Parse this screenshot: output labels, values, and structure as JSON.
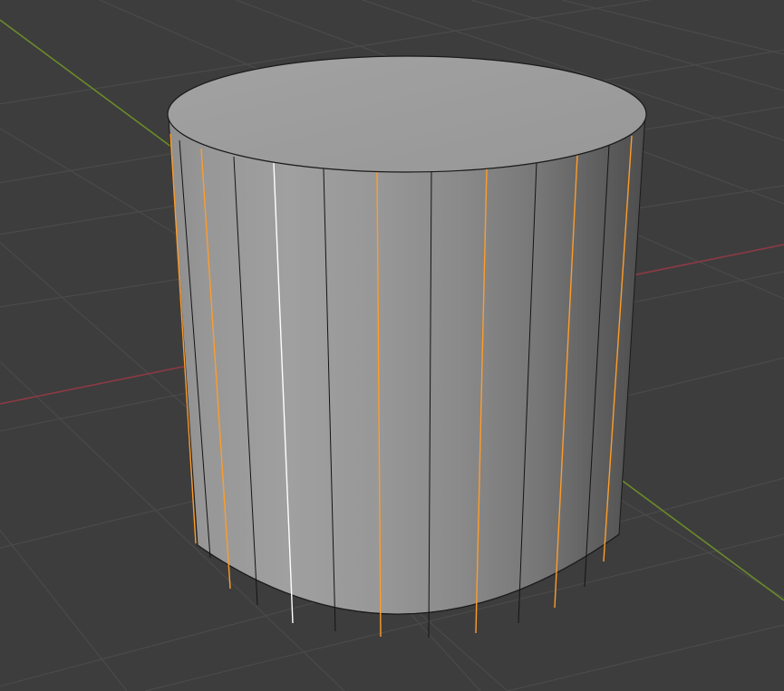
{
  "viewport": {
    "background": "#3d3d3d",
    "grid_color": "#4b4b4b",
    "x_axis_color": "#8c3a44",
    "y_axis_color": "#6b8a2a",
    "view": "perspective",
    "mode": "edit",
    "selection_mode": "edge"
  },
  "mesh": {
    "object": "cylinder",
    "vertices_per_ring": 32,
    "selected_edge_color": "#ff9c2a",
    "active_edge_color": "#ffffff",
    "unselected_edge_color": "#141414",
    "vertical_edges": [
      {
        "state": "selected"
      },
      {
        "state": "unselected"
      },
      {
        "state": "selected"
      },
      {
        "state": "unselected"
      },
      {
        "state": "active"
      },
      {
        "state": "unselected"
      },
      {
        "state": "selected"
      },
      {
        "state": "unselected"
      },
      {
        "state": "selected"
      },
      {
        "state": "unselected"
      },
      {
        "state": "selected"
      },
      {
        "state": "unselected"
      },
      {
        "state": "selected"
      }
    ]
  }
}
